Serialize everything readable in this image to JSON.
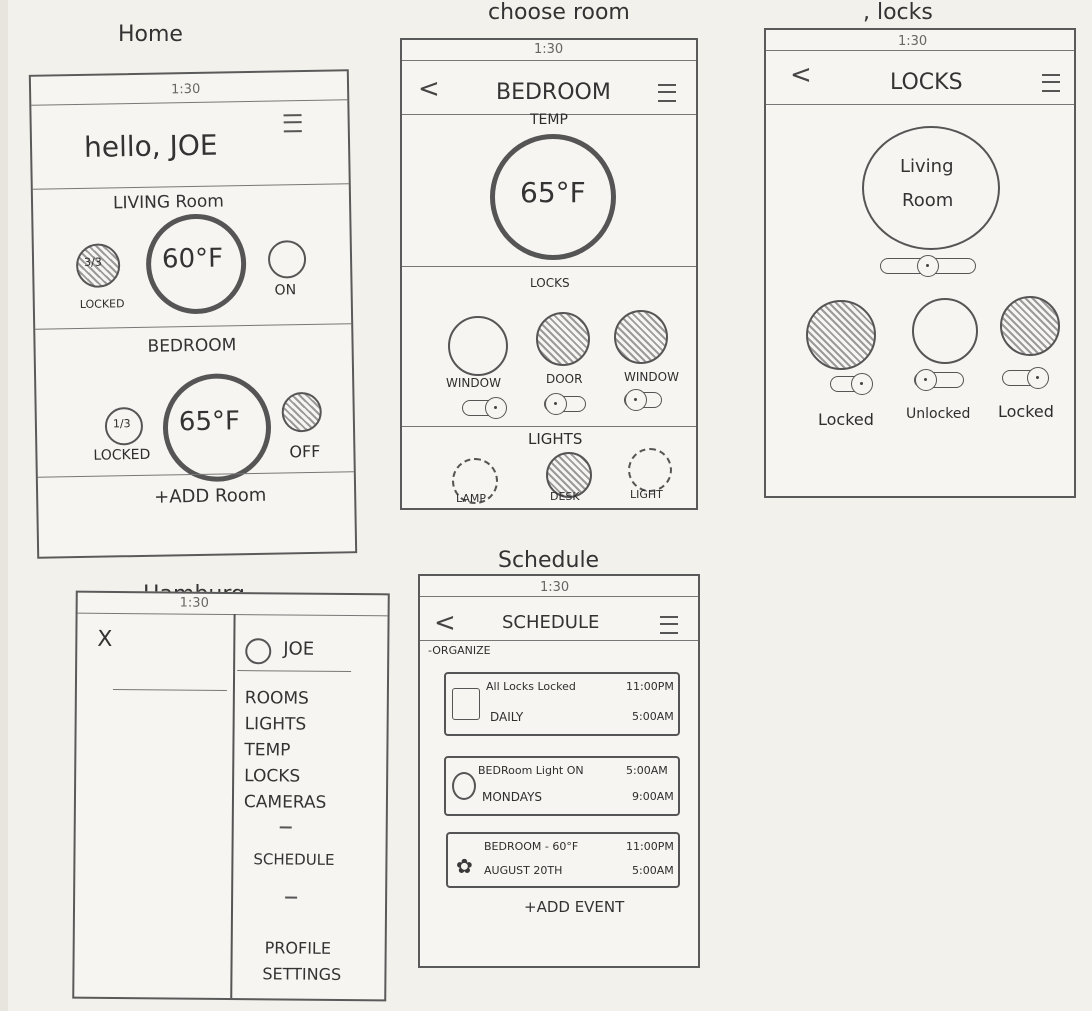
{
  "captions": {
    "home": "Home",
    "choose_room": "choose room",
    "locks": ", locks",
    "hamburg": "Hamburg",
    "schedule": "Schedule"
  },
  "status_time": "1:30",
  "home": {
    "greeting": "hello, JOE",
    "living_room": {
      "title": "LIVING Room",
      "lock_icon_text": "3/3",
      "lock_status": "LOCKED",
      "temp": "60°F",
      "light_status": "ON"
    },
    "bedroom": {
      "title": "BEDROOM",
      "lock_icon_text": "1/3",
      "lock_status": "LOCKED",
      "temp": "65°F",
      "light_status": "OFF"
    },
    "add_room": "+ADD Room"
  },
  "bedroom_screen": {
    "title": "BEDROOM",
    "temp_label": "TEMP",
    "temp": "65°F",
    "locks_label": "LOCKS",
    "locks": [
      "WINDOW",
      "DOOR",
      "WINDOW"
    ],
    "lights_label": "LIGHTS",
    "lights": [
      "LAMP",
      "DESK",
      "LIGHT"
    ]
  },
  "locks_screen": {
    "title": "LOCKS",
    "room_line1": "Living",
    "room_line2": "Room",
    "items": [
      "Locked",
      "Unlocked",
      "Locked"
    ]
  },
  "menu": {
    "close": "X",
    "user": "JOE",
    "items": [
      "ROOMS",
      "LIGHTS",
      "TEMP",
      "LOCKS",
      "CAMERAS"
    ],
    "schedule": "SCHEDULE",
    "profile": "PROFILE",
    "settings": "SETTINGS"
  },
  "schedule_screen": {
    "title": "SCHEDULE",
    "organize": "-ORGANIZE",
    "events": [
      {
        "title": "All Locks Locked",
        "start": "11:00PM",
        "repeat": "DAILY",
        "end": "5:00AM"
      },
      {
        "title": "BEDRoom Light ON",
        "start": "5:00AM",
        "repeat": "MONDAYS",
        "end": "9:00AM"
      },
      {
        "title": "BEDROOM - 60°F",
        "start": "11:00PM",
        "repeat": "AUGUST 20TH",
        "end": "5:00AM"
      }
    ],
    "add_event": "+ADD EVENT"
  }
}
